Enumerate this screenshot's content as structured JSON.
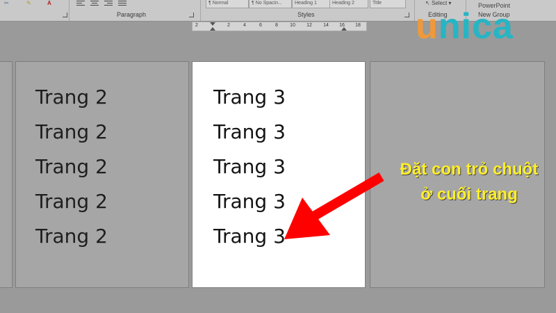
{
  "ribbon": {
    "groups": {
      "paragraph": "Paragraph",
      "styles": "Styles",
      "editing": "Editing",
      "new_group": "New Group"
    },
    "styles_gallery": [
      "¶ Normal",
      "¶ No Spacin...",
      "Heading 1",
      "Heading 2",
      "Title"
    ],
    "select_label": "Select",
    "powerpoint_label": "PowerPoint"
  },
  "ruler": {
    "ticks": [
      "2",
      "2",
      "4",
      "6",
      "8",
      "10",
      "12",
      "14",
      "16",
      "18"
    ]
  },
  "logo": {
    "first": "u",
    "rest": "nica"
  },
  "pages": {
    "left": {
      "lines": [
        "Trang 2",
        "Trang 2",
        "Trang 2",
        "Trang 2",
        "Trang 2"
      ]
    },
    "middle": {
      "lines": [
        "Trang 3",
        "Trang 3",
        "Trang 3",
        "Trang 3",
        "Trang 3"
      ]
    }
  },
  "annotation": {
    "line1": "Đặt con trỏ chuột",
    "line2": "ở cuối trang",
    "text_color": "#ffef2a",
    "arrow_color": "#ff0000"
  }
}
